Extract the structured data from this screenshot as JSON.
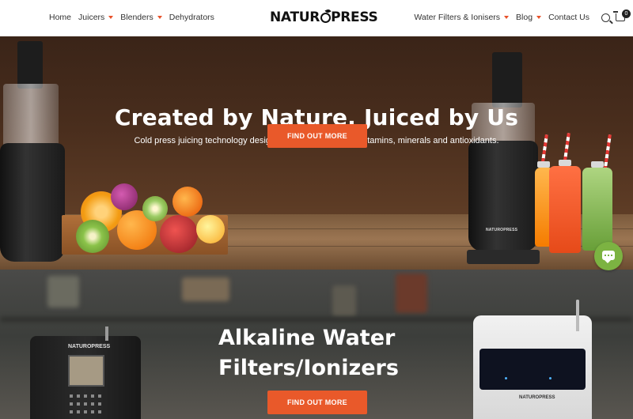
{
  "header": {
    "nav_left": [
      {
        "label": "Home",
        "has_dropdown": false
      },
      {
        "label": "Juicers",
        "has_dropdown": true
      },
      {
        "label": "Blenders",
        "has_dropdown": true
      },
      {
        "label": "Dehydrators",
        "has_dropdown": false
      }
    ],
    "logo_text_a": "NATUR",
    "logo_text_b": "PRESS",
    "nav_right": [
      {
        "label": "Water Filters & Ionisers",
        "has_dropdown": true
      },
      {
        "label": "Blog",
        "has_dropdown": true
      },
      {
        "label": "Contact Us",
        "has_dropdown": false
      }
    ],
    "cart_count": "0",
    "accent_color": "#e8512a"
  },
  "hero1": {
    "title": "Created by Nature, Juiced by Us",
    "subtitle": "Cold press juicing technology designed for higher yields of vitamins, minerals and antioxidants.",
    "cta_label": "FIND OUT MORE",
    "product_brand": "NATUROPRESS"
  },
  "hero2": {
    "title_line1": "Alkaline Water",
    "title_line2": "Filters/Ionizers",
    "cta_label": "FIND OUT MORE",
    "left_device_brand": "NATUROPRESS",
    "right_device_brand": "NATUROPRESS"
  },
  "chat": {
    "icon": "chat-bubble-icon",
    "color": "#7cb342"
  },
  "cta_color": "#e9592a"
}
